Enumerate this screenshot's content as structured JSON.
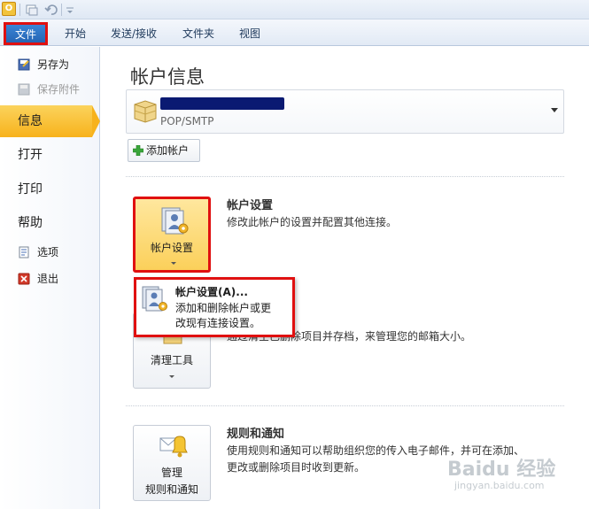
{
  "ribbon": {
    "tabs": [
      "文件",
      "开始",
      "发送/接收",
      "文件夹",
      "视图"
    ]
  },
  "nav": {
    "save_as": "另存为",
    "save_attachments": "保存附件",
    "info": "信息",
    "open": "打开",
    "print": "打印",
    "help": "帮助",
    "options": "选项",
    "exit": "退出"
  },
  "main": {
    "title": "帐户信息",
    "account": {
      "type": "POP/SMTP"
    },
    "add_account": "添加帐户",
    "account_settings": {
      "button_label": "帐户设置",
      "title": "帐户设置",
      "description": "修改此帐户的设置并配置其他连接。"
    },
    "cleanup": {
      "button_label": "清理工具",
      "description": "通过清空已删除项目并存档，来管理您的邮箱大小。"
    },
    "rules": {
      "button_line1": "管理",
      "button_line2": "规则和通知",
      "title": "规则和通知",
      "description_line1": "使用规则和通知可以帮助组织您的传入电子邮件，并可在添加、",
      "description_line2": "更改或删除项目时收到更新。"
    }
  },
  "popup": {
    "title": "帐户设置(A)...",
    "desc_line1": "添加和删除帐户或更",
    "desc_line2": "改现有连接设置。"
  },
  "watermark": {
    "brand": "Baidu 经验",
    "site": "jingyan.baidu.com"
  },
  "colors": {
    "highlight_border": "#e01010",
    "active_nav": "#f7b21c",
    "file_tab": "#2565b4"
  }
}
